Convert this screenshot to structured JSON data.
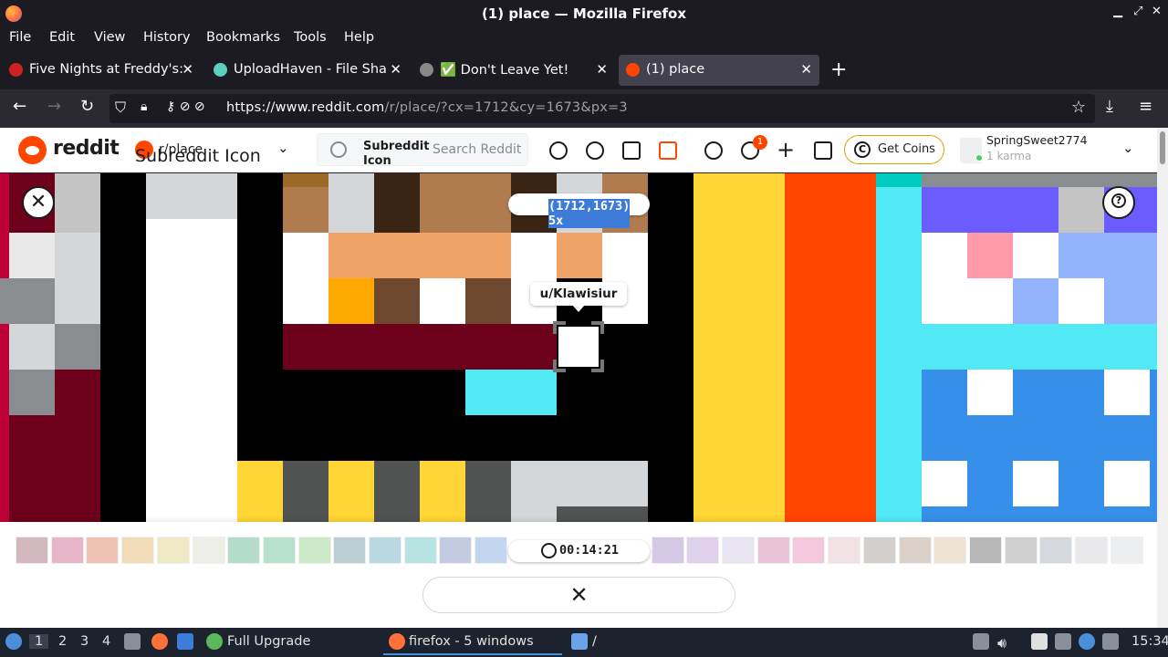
{
  "window": {
    "title": "(1) place — Mozilla Firefox"
  },
  "menu": [
    "File",
    "Edit",
    "View",
    "History",
    "Bookmarks",
    "Tools",
    "Help"
  ],
  "tabs": [
    {
      "label": "Five Nights at Freddy's: S",
      "color": "#cc2222"
    },
    {
      "label": "UploadHaven - File Shari",
      "color": "#5ccfc0"
    },
    {
      "label": "✅ Don't Leave Yet!",
      "color": "#888888"
    },
    {
      "label": "(1) place",
      "color": "#ff4500",
      "active": true
    }
  ],
  "url": {
    "host": "https://www.reddit.com",
    "path": "/r/place/?cx=1712&cy=1673&px=3"
  },
  "reddit": {
    "logo_text": "reddit",
    "subreddit": "r/place",
    "subreddit_icon_alt": "Subreddit Icon",
    "search_chip": "Subreddit Icon",
    "search_placeholder": "Search Reddit",
    "notification_count": "1",
    "coins_label": "Get Coins",
    "username": "SpringSweet2774",
    "karma": "1 karma"
  },
  "canvas": {
    "coords": "(1712,1673) 5x",
    "hover_user": "u/Klawisiur",
    "cooldown": "00:14:21"
  },
  "palette": [
    "#d4b8c0",
    "#e6b5c8",
    "#f0c2b3",
    "#f2dcb8",
    "#efe8c4",
    "#edefe6",
    "#b4dccb",
    "#b8e2cb",
    "#cce9c5",
    "#bccdd3",
    "#b9d8e1",
    "#b7e3e2",
    "#c3cbe3",
    "#c3d6ef",
    "#ffffff",
    "#ffffff",
    "#ffffff",
    "#ffffff",
    "#d5c7e6",
    "#dfd0ec",
    "#e7e3f0",
    "#ebc3d8",
    "#f3c7dc",
    "#f1e1e4",
    "#d2cfcd",
    "#d9d1c7",
    "#ede2d3",
    "#b8b8b8",
    "#cfcfcf",
    "#d5d9de",
    "#e9e9ec",
    "#edeeef"
  ],
  "taskbar": {
    "workspaces": [
      "1",
      "2",
      "3",
      "4"
    ],
    "upgrade": "Full Upgrade",
    "firefox": "firefox - 5 windows",
    "folder": "/",
    "clock": "15:34"
  }
}
